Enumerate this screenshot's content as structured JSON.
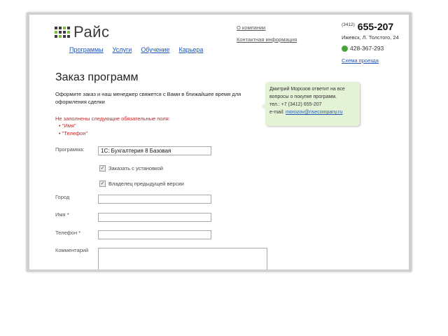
{
  "logo": {
    "text": "Райс",
    "dot_color": "#3d3d3d",
    "dot_accent": "#7cbd3c"
  },
  "nav": [
    {
      "label": "Программы"
    },
    {
      "label": "Услуги"
    },
    {
      "label": "Обучение"
    },
    {
      "label": "Карьера"
    }
  ],
  "toplinks": {
    "about": "О компании",
    "contacts": "Контактная информация"
  },
  "contacts": {
    "phone_code": "(3412)",
    "phone": "655-207",
    "address": "Ижевск, Л. Толстого, 24",
    "mobile": "428-367-293",
    "map_link": "Схема проезда"
  },
  "main": {
    "title": "Заказ программ",
    "intro": "Оформите заказ и наш менеджер свяжется с Вами в ближайшее время для оформления сделки"
  },
  "errors": {
    "heading": "Не заполнены следующие обязательные поля:",
    "items": [
      "\"Имя\"",
      "\"Телефон\""
    ]
  },
  "callout": {
    "line1": "Дмитрий Морозов ответит на все",
    "line2": "вопросы о покупке программ.",
    "phone": "тел.: +7 (3412) 655-207",
    "email_label": "e-mail:",
    "email": "morozov@risecompany.ru"
  },
  "form": {
    "program_label": "Программа:",
    "program_value": "1С: Бухгалтерия 8 Базовая",
    "check_install": "Заказать с установкой",
    "check_owner": "Владелец предыдущей версии",
    "city_label": "Город",
    "name_label": "Имя *",
    "phone_label": "Телефон *",
    "comment_label": "Комментарий"
  },
  "colors": {
    "link": "#1f56b3",
    "error": "#cc1f1f",
    "callout_bg": "#e4f3d6"
  }
}
